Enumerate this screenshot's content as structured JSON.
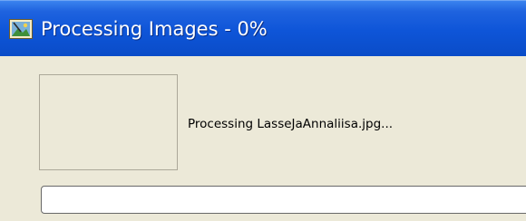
{
  "window": {
    "title": "Processing Images - 0%",
    "title_icon": "image-edit-app-icon"
  },
  "main": {
    "status_text": "Processing LasseJaAnnaliisa.jpg...",
    "progress_percent": 0
  },
  "colors": {
    "titlebar": "#0e55d8",
    "client_background": "#ece9d8",
    "progress_fill": "#2fbb2f"
  }
}
